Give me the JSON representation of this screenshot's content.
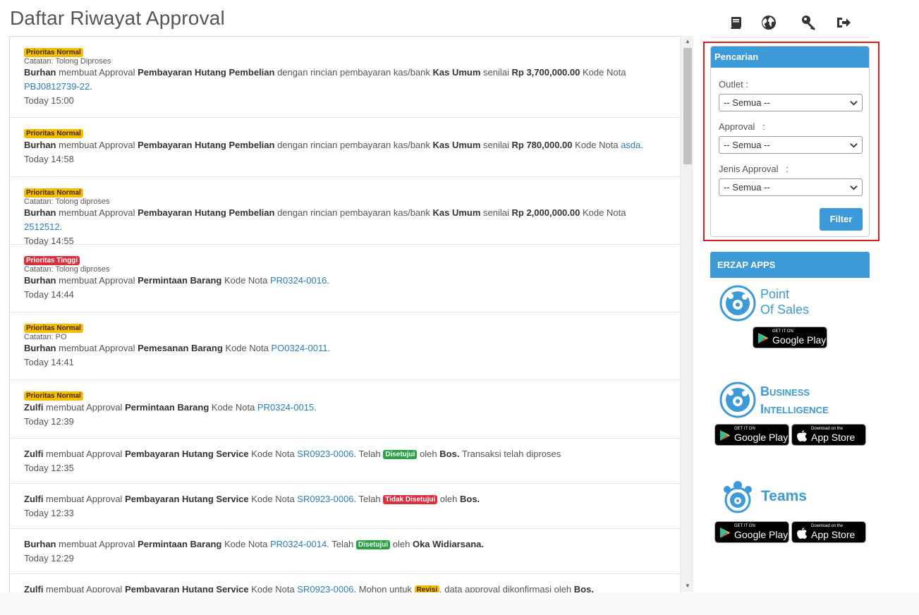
{
  "page_title": "Daftar Riwayat Approval",
  "colors": {
    "accent": "#3c9ad8",
    "link": "#2a7fc0",
    "badge_normal": "#f5bd00",
    "badge_danger": "#d9303c",
    "badge_success": "#27a244",
    "highlight": "#e01919"
  },
  "feed": [
    {
      "badge": "Prioritas Normal",
      "note": "Catatan: Tolong Diproses",
      "user": "Burhan",
      "w1": " membuat Approval ",
      "type": "Pembayaran Hutang Pembelian",
      "w2": " dengan rincian pembayaran kas/bank ",
      "kas": "Kas Umum",
      "w3": " senilai ",
      "amount": "Rp 3,700,000.00",
      "w4": " Kode Nota ",
      "code": "PBJ0812739-22",
      "end": ".",
      "time": "Today 15:00"
    },
    {
      "badge": "Prioritas Normal",
      "user": "Burhan",
      "w1": " membuat Approval ",
      "type": "Pembayaran Hutang Pembelian",
      "w2": " dengan rincian pembayaran kas/bank ",
      "kas": "Kas Umum",
      "w3": " senilai ",
      "amount": "Rp 780,000.00",
      "w4": " Kode Nota ",
      "code": "asda",
      "end": ".",
      "time": "Today 14:58"
    },
    {
      "badge": "Prioritas Normal",
      "note": "Catatan: Tolong diproses",
      "user": "Burhan",
      "w1": " membuat Approval ",
      "type": "Pembayaran Hutang Pembelian",
      "w2": " dengan rincian pembayaran kas/bank ",
      "kas": "Kas Umum",
      "w3": " senilai ",
      "amount": "Rp 2,000,000.00",
      "w4": " Kode Nota ",
      "code": "2512512",
      "end": ".",
      "time": "Today 14:55"
    },
    {
      "badge": "Prioritas Tinggi",
      "note": "Catatan: Tolong diproses",
      "user": "Burhan",
      "w1": " membuat Approval ",
      "type": "Permintaan Barang",
      "w4": " Kode Nota ",
      "code": "PR0324-0016",
      "end": ".",
      "time": "Today 14:44"
    },
    {
      "badge": "Prioritas Normal",
      "note": "Catatan: PO",
      "user": "Burhan",
      "w1": " membuat Approval ",
      "type": "Pemesanan Barang",
      "w4": " Kode Nota ",
      "code": "PO0324-0011",
      "end": ".",
      "time": "Today 14:41"
    },
    {
      "badge": "Prioritas Normal",
      "user": "Zulfi",
      "w1": " membuat Approval ",
      "type": "Permintaan Barang",
      "w4": " Kode Nota ",
      "code": "PR0324-0015",
      "end": ".",
      "time": "Today 12:39"
    },
    {
      "user": "Zulfi",
      "w1": " membuat Approval ",
      "type": "Pembayaran Hutang Service",
      "w4": " Kode Nota ",
      "code": "SR0923-0006",
      "w5": ". Telah ",
      "status": "Disetujui",
      "w6": " oleh ",
      "by": "Bos.",
      "w7": " Transaksi telah diproses",
      "time": "Today 12:35"
    },
    {
      "user": "Zulfi",
      "w1": " membuat Approval ",
      "type": "Pembayaran Hutang Service",
      "w4": " Kode Nota ",
      "code": "SR0923-0006",
      "w5": ". Telah ",
      "status": "Tidak Disetujui",
      "w6": " oleh ",
      "by": "Bos.",
      "time": "Today 12:33"
    },
    {
      "user": "Burhan",
      "w1": " membuat Approval ",
      "type": "Permintaan Barang",
      "w4": " Kode Nota ",
      "code": "PR0324-0014",
      "w5": ". Telah ",
      "status": "Disetujui",
      "w6": " oleh ",
      "by": "Oka Widiarsana.",
      "time": "Today 12:29"
    },
    {
      "user": "Zulfi",
      "w1": " membuat Approval ",
      "type": "Pembayaran Hutang Service",
      "w4": " Kode Nota ",
      "code": "SR0923-0006",
      "w5": ". Mohon untuk ",
      "status": "Revisi",
      "w6": ", data approval dikonfirmasi oleh ",
      "by": "Bos.",
      "time": ""
    }
  ],
  "top_icons": [
    "book-icon",
    "globe-icon",
    "key-icon",
    "sign-out-icon"
  ],
  "search": {
    "title": "Pencarian",
    "outlet_label": "Outlet :",
    "outlet_value": "-- Semua --",
    "approval_label": "Approval   :",
    "approval_value": "-- Semua --",
    "jenis_label": "Jenis Approval   :",
    "jenis_value": "-- Semua --",
    "filter_label": "Filter"
  },
  "apps": {
    "title": "ERZAP APPS",
    "pos_line1": "Point",
    "pos_line2": "Of Sales",
    "bi_line1": "Business",
    "bi_line2": "Intelligence",
    "teams": "Teams",
    "gp_small": "GET IT ON",
    "gp_big": "Google Play",
    "as_small": "Download on the",
    "as_big": "App Store"
  }
}
